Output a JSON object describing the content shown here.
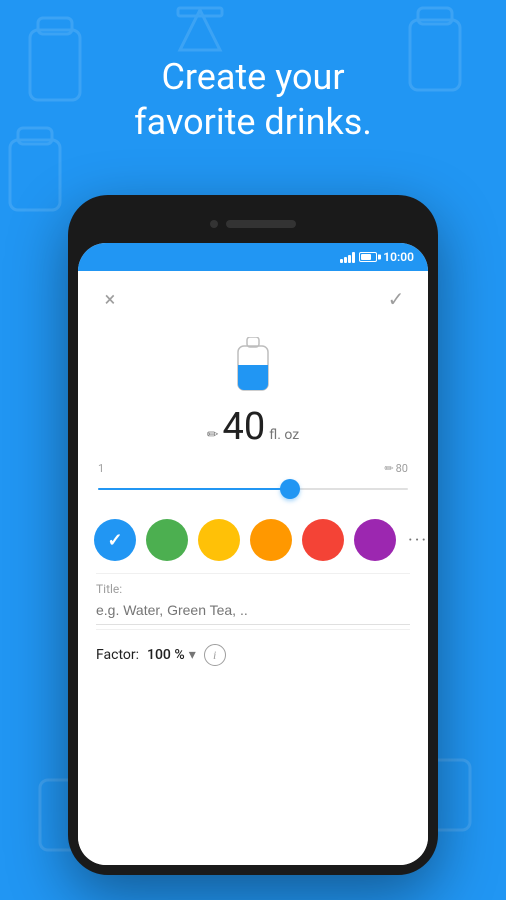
{
  "hero": {
    "line1": "Create your",
    "line2": "favorite drinks."
  },
  "status_bar": {
    "time": "10:00"
  },
  "toolbar": {
    "close_label": "×",
    "confirm_label": "✓"
  },
  "drink": {
    "volume_number": "40",
    "volume_unit": "fl. oz",
    "slider_min": "1",
    "slider_max": "80",
    "slider_percent": 62
  },
  "colors": [
    {
      "id": "blue",
      "hex": "#2196F3",
      "selected": true
    },
    {
      "id": "green",
      "hex": "#4CAF50",
      "selected": false
    },
    {
      "id": "yellow",
      "hex": "#FFC107",
      "selected": false
    },
    {
      "id": "orange",
      "hex": "#FF9800",
      "selected": false
    },
    {
      "id": "red",
      "hex": "#F44336",
      "selected": false
    },
    {
      "id": "purple",
      "hex": "#9C27B0",
      "selected": false
    }
  ],
  "title_field": {
    "label": "Title:",
    "placeholder": "e.g. Water, Green Tea, .."
  },
  "factor": {
    "label": "Factor:",
    "value": "100 %"
  }
}
